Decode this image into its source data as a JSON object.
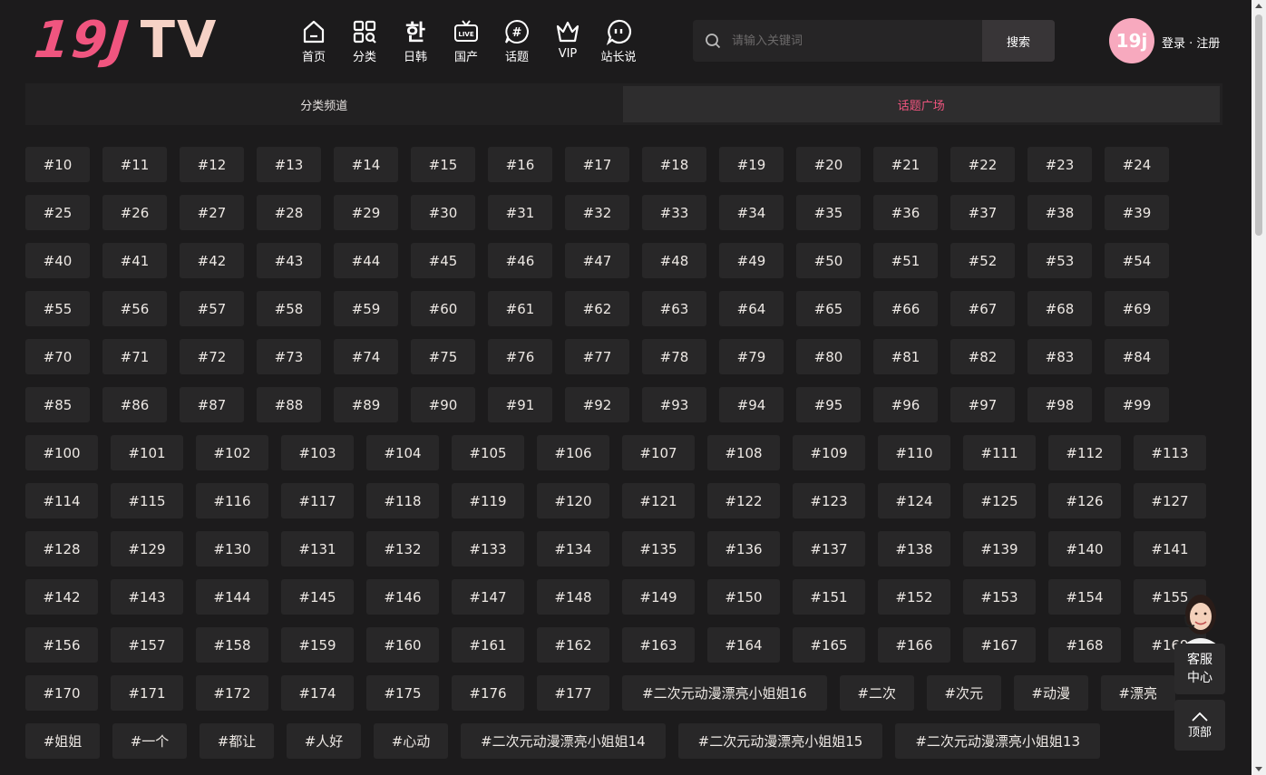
{
  "header": {
    "logo_part1": "19J",
    "logo_part2": "TV",
    "nav": [
      {
        "label": "首页",
        "icon": "home-icon"
      },
      {
        "label": "分类",
        "icon": "grid-search-icon"
      },
      {
        "label": "日韩",
        "icon": "hangul-icon"
      },
      {
        "label": "国产",
        "icon": "live-tv-icon"
      },
      {
        "label": "话题",
        "icon": "hashtag-bubble-icon"
      },
      {
        "label": "VIP",
        "icon": "crown-icon"
      },
      {
        "label": "站长说",
        "icon": "chat-bubble-icon"
      }
    ],
    "search_placeholder": "请输入关键词",
    "search_button": "搜索",
    "avatar_text": "19j",
    "auth_text": "登录 · 注册"
  },
  "tabs": [
    {
      "label": "分类频道",
      "active": false
    },
    {
      "label": "话题广场",
      "active": true
    }
  ],
  "colors": {
    "accent": "#f0557f",
    "bg": "#1c1b1c",
    "tag_bg": "#282728"
  },
  "tag_rows": [
    [
      "#10",
      "#11",
      "#12",
      "#13",
      "#14",
      "#15",
      "#16",
      "#17",
      "#18",
      "#19",
      "#20",
      "#21",
      "#22",
      "#23",
      "#24"
    ],
    [
      "#25",
      "#26",
      "#27",
      "#28",
      "#29",
      "#30",
      "#31",
      "#32",
      "#33",
      "#34",
      "#35",
      "#36",
      "#37",
      "#38",
      "#39"
    ],
    [
      "#40",
      "#41",
      "#42",
      "#43",
      "#44",
      "#45",
      "#46",
      "#47",
      "#48",
      "#49",
      "#50",
      "#51",
      "#52",
      "#53",
      "#54"
    ],
    [
      "#55",
      "#56",
      "#57",
      "#58",
      "#59",
      "#60",
      "#61",
      "#62",
      "#63",
      "#64",
      "#65",
      "#66",
      "#67",
      "#68",
      "#69"
    ],
    [
      "#70",
      "#71",
      "#72",
      "#73",
      "#74",
      "#75",
      "#76",
      "#77",
      "#78",
      "#79",
      "#80",
      "#81",
      "#82",
      "#83",
      "#84"
    ],
    [
      "#85",
      "#86",
      "#87",
      "#88",
      "#89",
      "#90",
      "#91",
      "#92",
      "#93",
      "#94",
      "#95",
      "#96",
      "#97",
      "#98",
      "#99"
    ],
    [
      "#100",
      "#101",
      "#102",
      "#103",
      "#104",
      "#105",
      "#106",
      "#107",
      "#108",
      "#109",
      "#110",
      "#111",
      "#112",
      "#113"
    ],
    [
      "#114",
      "#115",
      "#116",
      "#117",
      "#118",
      "#119",
      "#120",
      "#121",
      "#122",
      "#123",
      "#124",
      "#125",
      "#126",
      "#127"
    ],
    [
      "#128",
      "#129",
      "#130",
      "#131",
      "#132",
      "#133",
      "#134",
      "#135",
      "#136",
      "#137",
      "#138",
      "#139",
      "#140",
      "#141"
    ],
    [
      "#142",
      "#143",
      "#144",
      "#145",
      "#146",
      "#147",
      "#148",
      "#149",
      "#150",
      "#151",
      "#152",
      "#153",
      "#154",
      "#155"
    ],
    [
      "#156",
      "#157",
      "#158",
      "#159",
      "#160",
      "#161",
      "#162",
      "#163",
      "#164",
      "#165",
      "#166",
      "#167",
      "#168",
      "#169"
    ],
    [
      "#170",
      "#171",
      "#172",
      "#174",
      "#175",
      "#176",
      "#177",
      "#二次元动漫漂亮小姐姐16",
      "#二次",
      "#次元",
      "#动漫",
      "#漂亮"
    ],
    [
      "#姐姐",
      "#一个",
      "#都让",
      "#人好",
      "#心动",
      "#二次元动漫漂亮小姐姐14",
      "#二次元动漫漂亮小姐姐15",
      "#二次元动漫漂亮小姐姐13"
    ]
  ],
  "float": {
    "service_label": "客服中心",
    "top_label": "顶部"
  }
}
